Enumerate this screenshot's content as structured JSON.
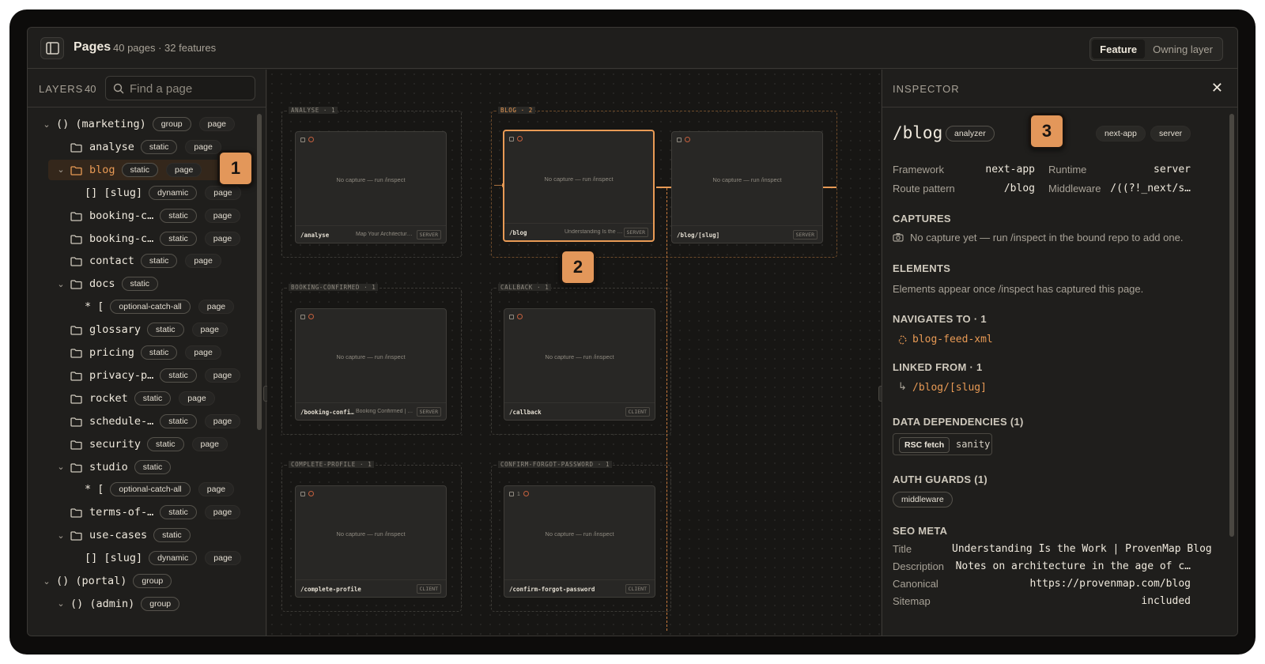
{
  "header": {
    "title": "Pages",
    "subtitle": "40 pages · 32 features",
    "view_options": [
      "Feature",
      "Owning layer"
    ],
    "active_view": "Feature"
  },
  "layers": {
    "title": "LAYERS",
    "count": "40",
    "search_placeholder": "Find a page",
    "rows": [
      {
        "chev": "v",
        "icon": "group",
        "name": "() (marketing)",
        "badges": [
          "group",
          "page"
        ]
      },
      {
        "chev": "",
        "icon": "folder",
        "name": "analyse",
        "badges": [
          "static",
          "page"
        ]
      },
      {
        "chev": "v",
        "icon": "folder",
        "name": "blog",
        "badges": [
          "static",
          "page"
        ],
        "selected": true
      },
      {
        "chev": "",
        "icon": "none",
        "name": "[] [slug]",
        "badges": [
          "dynamic",
          "page"
        ]
      },
      {
        "chev": "",
        "icon": "folder",
        "name": "booking-c…",
        "badges": [
          "static",
          "page"
        ]
      },
      {
        "chev": "",
        "icon": "folder",
        "name": "booking-c…",
        "badges": [
          "static",
          "page"
        ]
      },
      {
        "chev": "",
        "icon": "folder",
        "name": "contact",
        "badges": [
          "static",
          "page"
        ]
      },
      {
        "chev": "v",
        "icon": "folder",
        "name": "docs",
        "badges": [
          "static"
        ]
      },
      {
        "chev": "",
        "icon": "none",
        "name": "* [",
        "badges": [
          "optional-catch-all",
          "page"
        ]
      },
      {
        "chev": "",
        "icon": "folder",
        "name": "glossary",
        "badges": [
          "static",
          "page"
        ]
      },
      {
        "chev": "",
        "icon": "folder",
        "name": "pricing",
        "badges": [
          "static",
          "page"
        ]
      },
      {
        "chev": "",
        "icon": "folder",
        "name": "privacy-p…",
        "badges": [
          "static",
          "page"
        ]
      },
      {
        "chev": "",
        "icon": "folder",
        "name": "rocket",
        "badges": [
          "static",
          "page"
        ]
      },
      {
        "chev": "",
        "icon": "folder",
        "name": "schedule-…",
        "badges": [
          "static",
          "page"
        ]
      },
      {
        "chev": "",
        "icon": "folder",
        "name": "security",
        "badges": [
          "static",
          "page"
        ]
      },
      {
        "chev": "v",
        "icon": "folder",
        "name": "studio",
        "badges": [
          "static"
        ]
      },
      {
        "chev": "",
        "icon": "none",
        "name": "* [",
        "badges": [
          "optional-catch-all",
          "page"
        ]
      },
      {
        "chev": "",
        "icon": "folder",
        "name": "terms-of-…",
        "badges": [
          "static",
          "page"
        ]
      },
      {
        "chev": "v",
        "icon": "folder",
        "name": "use-cases",
        "badges": [
          "static"
        ]
      },
      {
        "chev": "",
        "icon": "none",
        "name": "[] [slug]",
        "badges": [
          "dynamic",
          "page"
        ]
      },
      {
        "chev": "v",
        "icon": "group",
        "name": "() (portal)",
        "badges": [
          "group"
        ]
      },
      {
        "chev": "v",
        "icon": "group",
        "name": "() (admin)",
        "badges": [
          "group"
        ]
      }
    ]
  },
  "canvas": {
    "groups": [
      {
        "label": "ANALYSE · 1",
        "highlight": false
      },
      {
        "label": "BLOG · 2",
        "highlight": true
      },
      {
        "label": "BOOKING-CONFIRMED · 1",
        "highlight": false
      },
      {
        "label": "CALLBACK · 1",
        "highlight": false
      },
      {
        "label": "COMPLETE-PROFILE · 1",
        "highlight": false
      },
      {
        "label": "CONFIRM-FORGOT-PASSWORD · 1",
        "highlight": false
      }
    ],
    "capture_text": "No capture — run /inspect",
    "cards": [
      {
        "path": "/analyse",
        "desc": "Map Your Architectur…",
        "type": "SERVER",
        "extra": ""
      },
      {
        "path": "/blog",
        "desc": "Understanding Is the …",
        "type": "SERVER",
        "extra": "",
        "selected": true
      },
      {
        "path": "/blog/[slug]",
        "desc": "",
        "type": "SERVER",
        "extra": ""
      },
      {
        "path": "/booking-confi…",
        "desc": "Booking Confirmed | …",
        "type": "SERVER",
        "extra": ""
      },
      {
        "path": "/callback",
        "desc": "",
        "type": "CLIENT",
        "extra": ""
      },
      {
        "path": "/complete-profile",
        "desc": "",
        "type": "CLIENT",
        "extra": ""
      },
      {
        "path": "/confirm-forgot-password",
        "desc": "",
        "type": "CLIENT",
        "extra": "1"
      }
    ],
    "callouts": [
      "1",
      "2",
      "3"
    ]
  },
  "inspector": {
    "title": "INSPECTOR",
    "path": "/blog",
    "source_badge": "analyzer",
    "tags": [
      "next-app",
      "server"
    ],
    "framework_label": "Framework",
    "framework": "next-app",
    "runtime_label": "Runtime",
    "runtime": "server",
    "route_label": "Route pattern",
    "route": "/blog",
    "middleware_label": "Middleware",
    "middleware": "/((?!_next/s…",
    "captures_title": "CAPTURES",
    "captures_text": "No capture yet — run /inspect in the bound repo to add one.",
    "elements_title": "ELEMENTS",
    "elements_text": "Elements appear once /inspect has captured this page.",
    "navigates_title": "NAVIGATES TO · 1",
    "navigates": "blog-feed-xml",
    "linked_title": "LINKED FROM · 1",
    "linked": "/blog/[slug]",
    "deps_title": "DATA DEPENDENCIES (1)",
    "dep_kind": "RSC fetch",
    "dep_source": "sanity",
    "auth_title": "AUTH GUARDS (1)",
    "auth": "middleware",
    "seo_title": "SEO META",
    "seo": [
      {
        "k": "Title",
        "v": "Understanding Is the Work | ProvenMap Blog"
      },
      {
        "k": "Description",
        "v": "Notes on architecture in the age of c…"
      },
      {
        "k": "Canonical",
        "v": "https://provenmap.com/blog"
      },
      {
        "k": "Sitemap",
        "v": "included"
      }
    ]
  },
  "colors": {
    "accent": "#e89a55",
    "callout": "#e3975a",
    "bg": "#1f1e1c"
  }
}
